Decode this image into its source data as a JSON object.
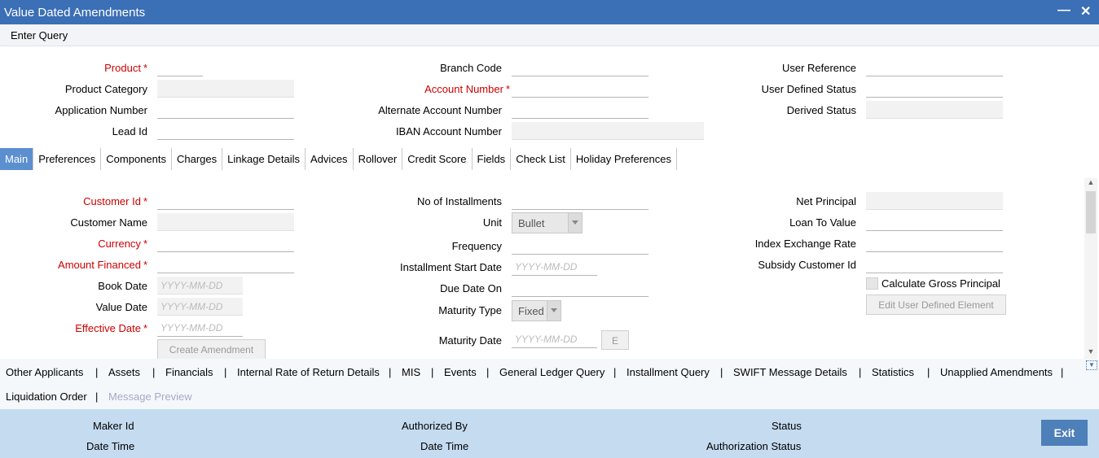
{
  "window": {
    "title": "Value Dated Amendments",
    "minimize_icon": "minimize-icon",
    "close_icon": "close-icon"
  },
  "menu": {
    "enter_query": "Enter Query"
  },
  "header": {
    "product": "Product",
    "product_category": "Product Category",
    "application_number": "Application Number",
    "lead_id": "Lead Id",
    "branch_code": "Branch Code",
    "account_number": "Account Number",
    "alternate_account_number": "Alternate Account Number",
    "iban_account_number": "IBAN Account Number",
    "user_reference": "User Reference",
    "user_defined_status": "User Defined Status",
    "derived_status": "Derived Status"
  },
  "tabs": [
    "Main",
    "Preferences",
    "Components",
    "Charges",
    "Linkage Details",
    "Advices",
    "Rollover",
    "Credit Score",
    "Fields",
    "Check List",
    "Holiday Preferences"
  ],
  "main": {
    "customer_id": "Customer Id",
    "customer_name": "Customer Name",
    "currency": "Currency",
    "amount_financed": "Amount Financed",
    "book_date": "Book Date",
    "value_date": "Value Date",
    "effective_date": "Effective Date",
    "date_placeholder": "YYYY-MM-DD",
    "create_amendment": "Create Amendment",
    "no_of_installments": "No of Installments",
    "unit": "Unit",
    "unit_value": "Bullet",
    "frequency": "Frequency",
    "installment_start_date": "Installment Start Date",
    "due_date_on": "Due Date On",
    "maturity_type": "Maturity Type",
    "maturity_type_value": "Fixed",
    "maturity_date": "Maturity Date",
    "e_button": "E",
    "net_principal": "Net Principal",
    "loan_to_value": "Loan To Value",
    "index_exchange_rate": "Index Exchange Rate",
    "subsidy_customer_id": "Subsidy Customer Id",
    "calculate_gross_principal": "Calculate Gross Principal",
    "edit_user_defined_element": "Edit User Defined Element"
  },
  "links": {
    "row1": [
      "Other Applicants",
      "Assets",
      "Financials",
      "Internal Rate of Return Details",
      "MIS",
      "Events",
      "General Ledger Query",
      "Installment Query",
      "SWIFT Message Details",
      "Statistics",
      "Unapplied Amendments"
    ],
    "row2": [
      "Liquidation Order",
      "Message Preview"
    ],
    "separator": "|"
  },
  "footer": {
    "maker_id": "Maker Id",
    "date_time": "Date Time",
    "authorized_by": "Authorized By",
    "status": "Status",
    "authorization_status": "Authorization Status",
    "exit": "Exit"
  },
  "colors": {
    "titlebar": "#3b6fb6",
    "active_tab": "#5b8fd0",
    "required": "#cc0000",
    "footer": "#c5dbef",
    "exit_button": "#4d7fb8"
  }
}
